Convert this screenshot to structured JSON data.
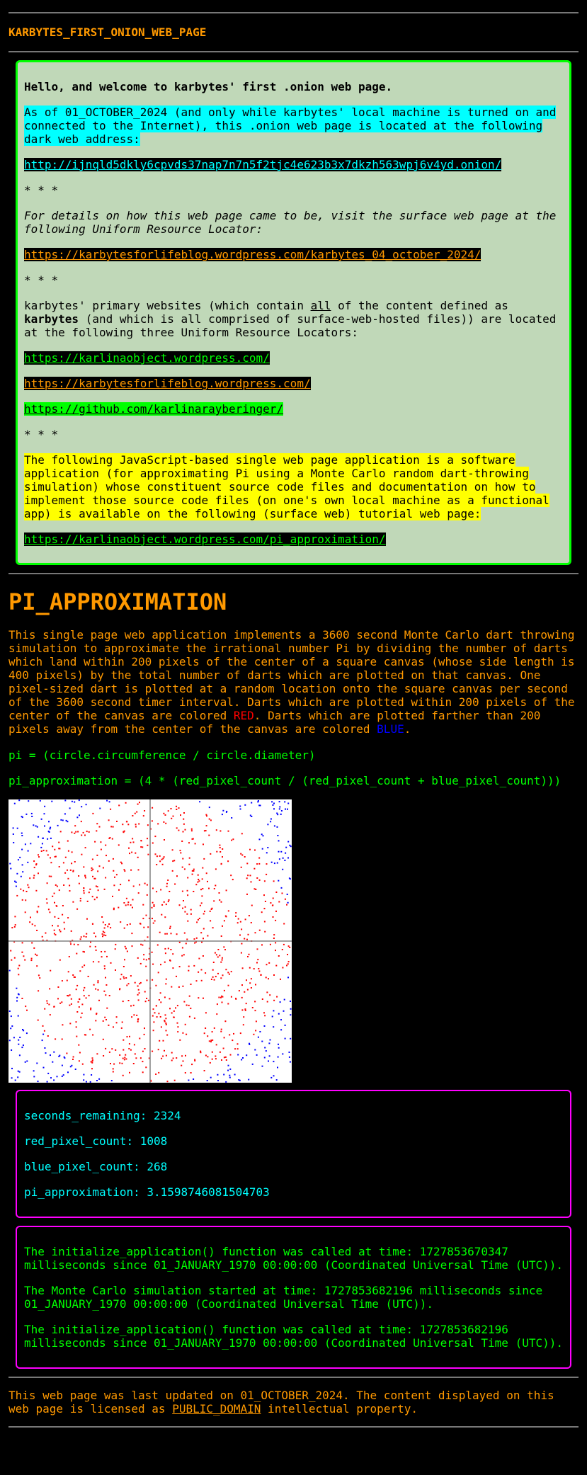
{
  "header": {
    "title": "KARBYTES_FIRST_ONION_WEB_PAGE"
  },
  "intro_box": {
    "welcome": "Hello, and welcome to karbytes' first .onion web page.",
    "address_note": "As of 01_OCTOBER_2024 (and only while karbytes' local machine is turned on and connected to the Internet), this .onion web page is located at the following dark web address:",
    "onion_link": "http://ijnqld5dkly6cpvds37nap7n7n5f2tjc4e623b3x7dkzh563wpj6v4yd.onion/",
    "separator": "* * *",
    "details_note": "For details on how this web page came to be, visit the surface web page at the following Uniform Resource Locator:",
    "details_link": "https://karbytesforlifeblog.wordpress.com/karbytes_04_october_2024/",
    "primary_pre": "karbytes' primary websites (which contain ",
    "primary_all": "all",
    "primary_mid": " of the content defined as ",
    "primary_name": "karbytes",
    "primary_post": " (and which is all comprised of surface-web-hosted files)) are located at the following three Uniform Resource Locators:",
    "site_links": [
      "https://karlinaobject.wordpress.com/",
      "https://karbytesforlifeblog.wordpress.com/",
      "https://github.com/karlinarayberinger/"
    ],
    "app_note": "The following JavaScript-based single web page application is a software application (for approximating Pi using a Monte Carlo random dart-throwing simulation) whose constituent source code files and documentation on how to implement those source code files (on one's own local machine as a functional app) is available on the following (surface web) tutorial web page:",
    "app_link": "https://karlinaobject.wordpress.com/pi_approximation/"
  },
  "app": {
    "heading": "PI_APPROXIMATION",
    "desc_1": "This single page web application implements a 3600 second Monte Carlo dart throwing simulation to approximate the irrational number Pi by dividing the number of darts which land within 200 pixels of the center of a square canvas (whose side length is 400 pixels) by the total number of darts which are plotted on that canvas. One pixel-sized dart is plotted at a random location onto the square canvas per second of the 3600 second timer interval. Darts which are plotted within 200 pixels of the center of the canvas are colored ",
    "desc_red": "RED",
    "desc_2": ". Darts which are plotted farther than 200 pixels away from the center of the canvas are colored ",
    "desc_blue": "BLUE",
    "desc_3": ".",
    "formula_1": "pi = (circle.circumference / circle.diameter)",
    "formula_2": "pi_approximation = (4 * (red_pixel_count / (red_pixel_count + blue_pixel_count)))",
    "canvas": {
      "background": "#ffffff",
      "axis_color": "#808080",
      "inside_color": "#ff0000",
      "outside_color": "#0000ff",
      "red_pixel_count": 1008,
      "blue_pixel_count": 268
    }
  },
  "stats": {
    "seconds_remaining": "seconds_remaining: 2324",
    "red_pixel_count": "red_pixel_count: 1008",
    "blue_pixel_count": "blue_pixel_count: 268",
    "pi_approximation": "pi_approximation: 3.1598746081504703"
  },
  "log": {
    "lines": [
      "The initialize_application() function was called at time: 1727853670347 milliseconds since 01_JANUARY_1970 00:00:00 (Coordinated Universal Time (UTC)).",
      "The Monte Carlo simulation started at time: 1727853682196 milliseconds since 01_JANUARY_1970 00:00:00 (Coordinated Universal Time (UTC)).",
      "The initialize_application() function was called at time: 1727853682196 milliseconds since 01_JANUARY_1970 00:00:00 (Coordinated Universal Time (UTC))."
    ]
  },
  "footer": {
    "text_pre": "This web page was last updated on 01_OCTOBER_2024. The content displayed on this web page is licensed as ",
    "license_link": "PUBLIC_DOMAIN",
    "text_post": " intellectual property."
  }
}
